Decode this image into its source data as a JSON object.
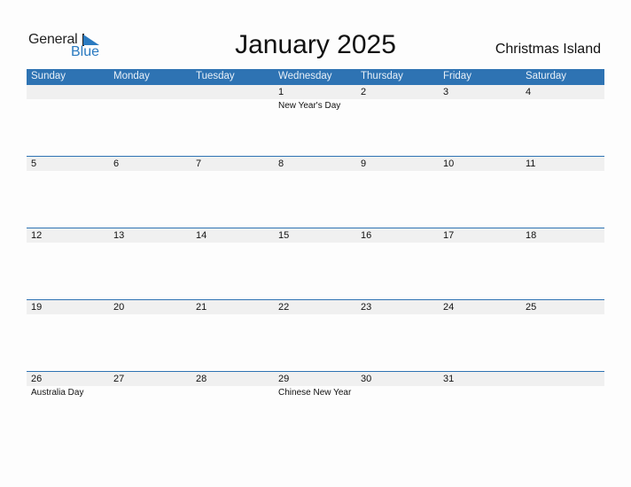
{
  "logo": {
    "line1": "General",
    "line2": "Blue",
    "accent": "#2a7ac0"
  },
  "title": "January 2025",
  "region": "Christmas Island",
  "colors": {
    "header_bg": "#2e73b3",
    "date_strip": "#f0f0f0"
  },
  "weekdays": [
    "Sunday",
    "Monday",
    "Tuesday",
    "Wednesday",
    "Thursday",
    "Friday",
    "Saturday"
  ],
  "weeks": [
    [
      {
        "day": ""
      },
      {
        "day": ""
      },
      {
        "day": ""
      },
      {
        "day": "1",
        "holiday": "New Year's Day"
      },
      {
        "day": "2"
      },
      {
        "day": "3"
      },
      {
        "day": "4"
      }
    ],
    [
      {
        "day": "5"
      },
      {
        "day": "6"
      },
      {
        "day": "7"
      },
      {
        "day": "8"
      },
      {
        "day": "9"
      },
      {
        "day": "10"
      },
      {
        "day": "11"
      }
    ],
    [
      {
        "day": "12"
      },
      {
        "day": "13"
      },
      {
        "day": "14"
      },
      {
        "day": "15"
      },
      {
        "day": "16"
      },
      {
        "day": "17"
      },
      {
        "day": "18"
      }
    ],
    [
      {
        "day": "19"
      },
      {
        "day": "20"
      },
      {
        "day": "21"
      },
      {
        "day": "22"
      },
      {
        "day": "23"
      },
      {
        "day": "24"
      },
      {
        "day": "25"
      }
    ],
    [
      {
        "day": "26",
        "holiday": "Australia Day"
      },
      {
        "day": "27"
      },
      {
        "day": "28"
      },
      {
        "day": "29",
        "holiday": "Chinese New Year"
      },
      {
        "day": "30"
      },
      {
        "day": "31"
      },
      {
        "day": ""
      }
    ]
  ]
}
